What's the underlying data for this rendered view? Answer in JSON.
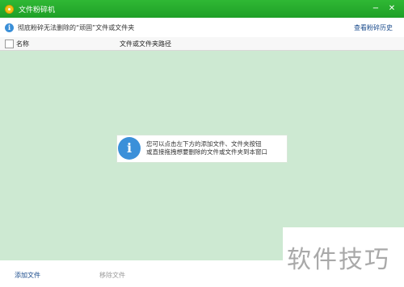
{
  "window": {
    "title": "文件粉碎机",
    "icon": "shredder-app-icon",
    "min_glyph": "−",
    "close_glyph": "✕"
  },
  "infobar": {
    "text": "彻底粉碎无法删除的“顽固”文件或文件夹",
    "history_link": "查看粉碎历史",
    "icon": "info-icon"
  },
  "table": {
    "columns": [
      "名称",
      "文件或文件夹路径"
    ]
  },
  "hint": {
    "icon": "info-icon",
    "line1": "您可以点击左下方的添加文件、文件夹按钮",
    "line2": "或直接拖拽想要删除的文件或文件夹到本窗口"
  },
  "bottom": {
    "add_label": "添加文件",
    "remove_label": "移除文件"
  },
  "watermark": {
    "text": "软件技巧"
  }
}
